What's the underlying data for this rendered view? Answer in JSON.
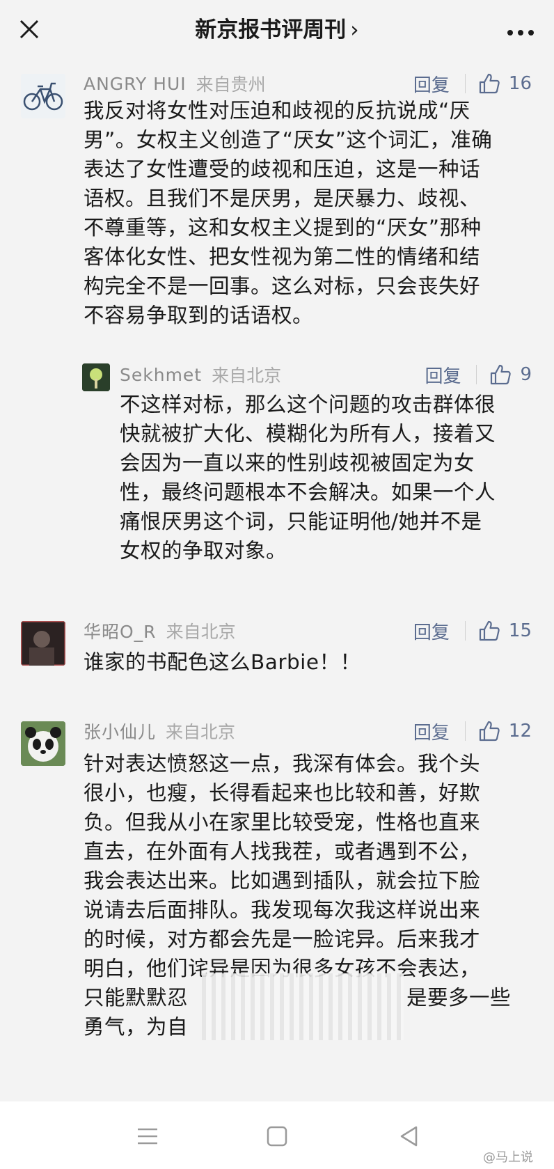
{
  "header": {
    "title": "新京报书评周刊",
    "title_chevron": "›"
  },
  "comments": [
    {
      "user": "ANGRY HUI",
      "location": "来自贵州",
      "reply_label": "回复",
      "likes": "16",
      "lines": [
        "我反对将女性对压迫和歧视的反抗说成“厌",
        "男”。女权主义创造了“厌女”这个词汇，准确",
        "表达了女性遭受的歧视和压迫，这是一种话",
        "语权。且我们不是厌男，是厌暴力、歧视、",
        "不尊重等，这和女权主义提到的“厌女”那种",
        "客体化女性、把女性视为第二性的情绪和结",
        "构完全不是一回事。这么对标，只会丧失好",
        "不容易争取到的话语权。"
      ],
      "reply": {
        "user": "Sekhmet",
        "location": "来自北京",
        "reply_label": "回复",
        "likes": "9",
        "lines": [
          "不这样对标，那么这个问题的攻击群体很",
          "快就被扩大化、模糊化为所有人，接着又",
          "会因为一直以来的性别歧视被固定为女",
          "性，最终问题根本不会解决。如果一个人",
          "痛恨厌男这个词，只能证明他/她并不是",
          "女权的争取对象。"
        ]
      }
    },
    {
      "user": "华昭O_R",
      "location": "来自北京",
      "reply_label": "回复",
      "likes": "15",
      "lines": [
        "谁家的书配色这么Barbie！！"
      ]
    },
    {
      "user": "张小仙儿",
      "location": "来自北京",
      "reply_label": "回复",
      "likes": "12",
      "lines": [
        "针对表达愤怒这一点，我深有体会。我个头",
        "很小，也瘦，长得看起来也比较和善，好欺",
        "负。但我从小在家里比较受宠，性格也直来",
        "直去，在外面有人找我茬，或者遇到不公，",
        "我会表达出来。比如遇到插队，就会拉下脸",
        "说请去后面排队。我发现每次我这样说出来",
        "的时候，对方都会先是一脸诧异。后来我才",
        "明白，他们诧异是因为很多女孩不会表达，",
        "只能默默忍"
      ],
      "line9_tail": "是要多一些",
      "line10": "勇气，为自"
    }
  ],
  "watermark": "@马上说",
  "colors": {
    "background": "#f3f3f3",
    "link_blue": "#5b6c8f",
    "username_gray": "#8a8a8a"
  },
  "icons": [
    "close-icon",
    "more-icon",
    "thumbs-up-icon",
    "menu-icon",
    "home-square-icon",
    "back-triangle-icon"
  ]
}
